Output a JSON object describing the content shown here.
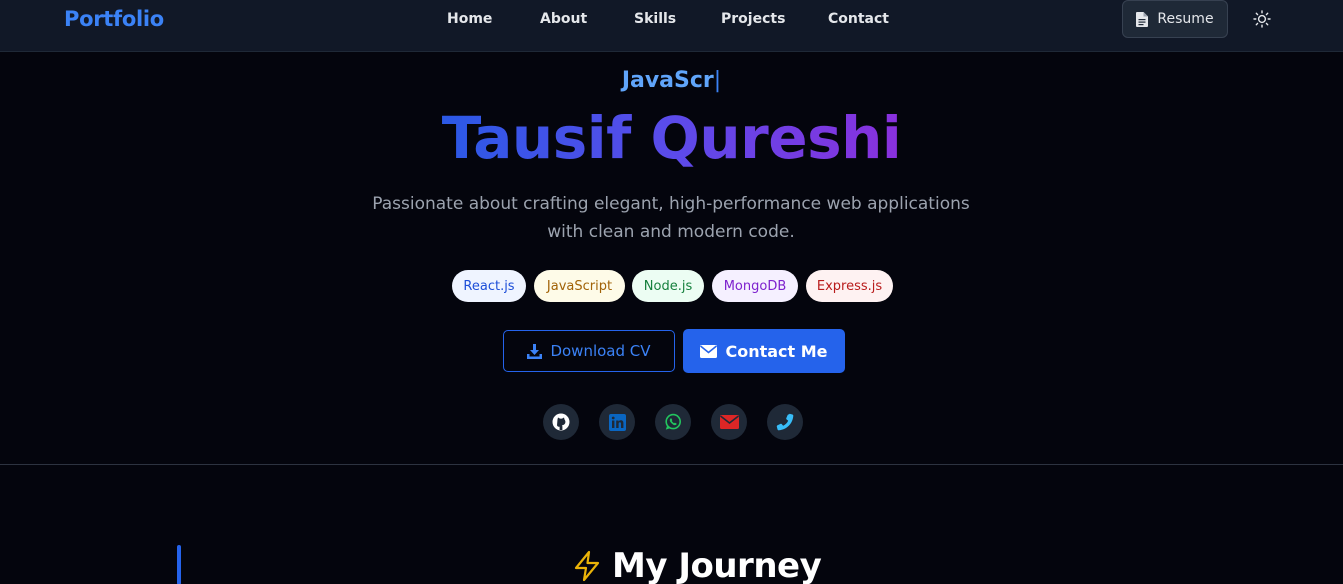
{
  "nav": {
    "logo": "Portfolio",
    "links": [
      "Home",
      "About",
      "Skills",
      "Projects",
      "Contact"
    ],
    "resume_label": "Resume",
    "theme_icon": "sun-icon"
  },
  "hero": {
    "typed_text": "JavaScr",
    "caret": "|",
    "name": "Tausif Qureshi",
    "tagline_line1": "Passionate about crafting elegant, high-performance web applications",
    "tagline_line2": "with clean and modern code.",
    "skills": [
      "React.js",
      "JavaScript",
      "Node.js",
      "MongoDB",
      "Express.js"
    ],
    "download_label": "Download CV",
    "contact_label": "Contact Me",
    "social_icons": [
      "github-icon",
      "linkedin-icon",
      "whatsapp-icon",
      "email-icon",
      "phone-icon"
    ]
  },
  "journey": {
    "title": "My Journey",
    "icon": "lightning-icon"
  },
  "colors": {
    "accent": "#2563eb",
    "background": "#04050d",
    "nav_background": "#111827"
  }
}
